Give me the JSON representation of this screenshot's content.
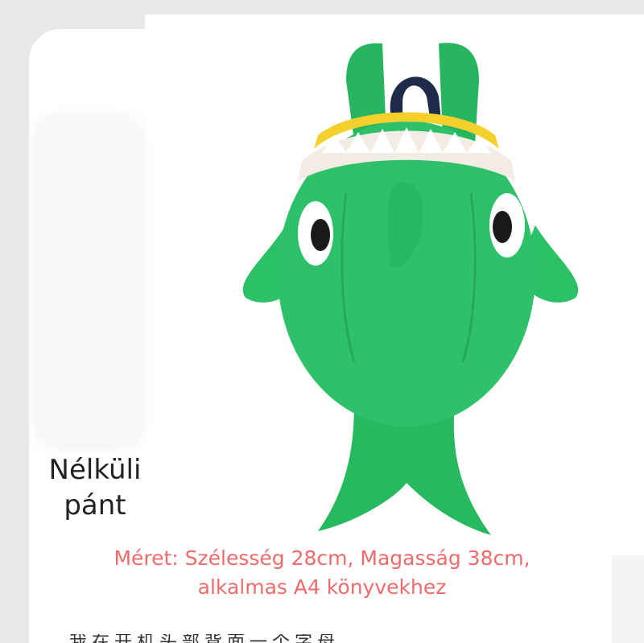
{
  "label": {
    "line1": "Nélküli",
    "line2": "pánt"
  },
  "spec": {
    "line1": "Méret: Szélesség 28cm, Magasság 38cm,",
    "line2": "alkalmas A4 könyvekhez"
  },
  "footer_cut": "我在开机头部背面一个字母",
  "colors": {
    "accent_text": "#ef6b6b",
    "bag_green": "#2fc06a"
  }
}
